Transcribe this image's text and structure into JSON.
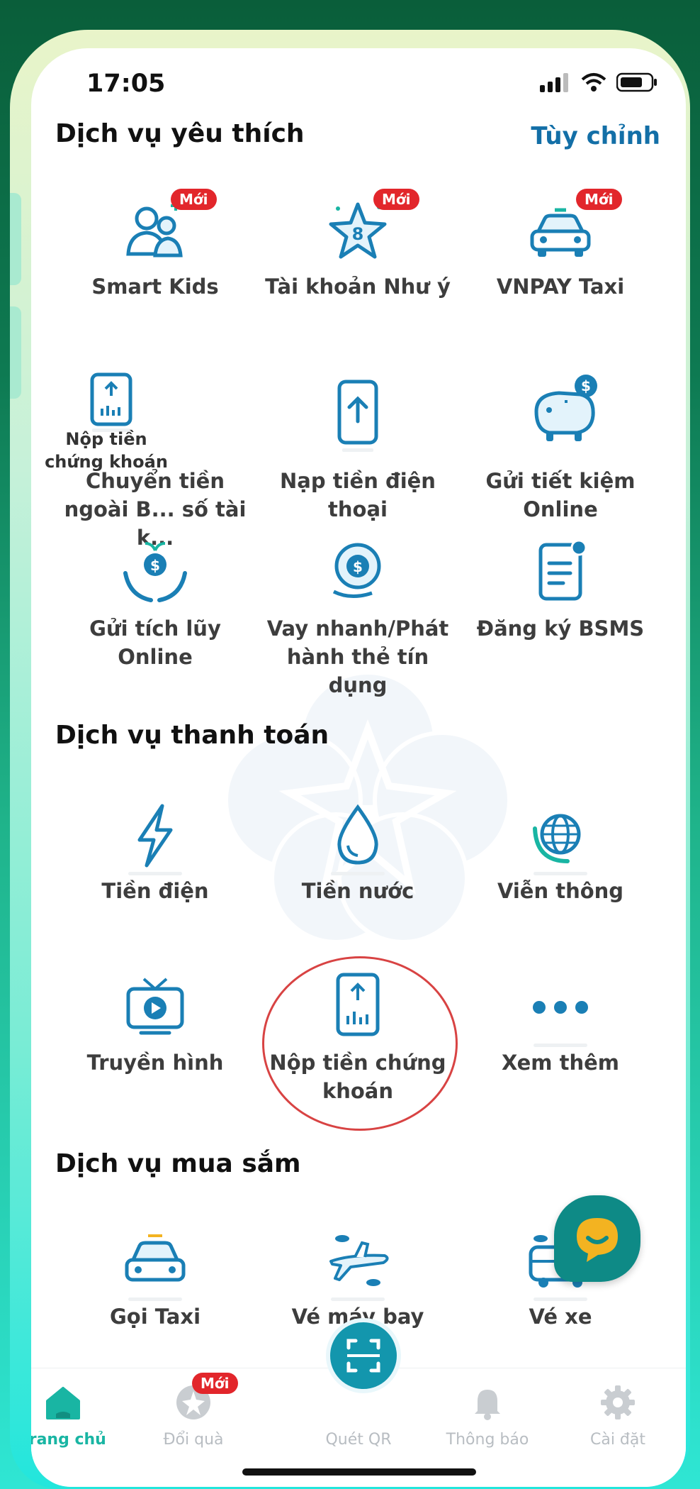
{
  "status_bar": {
    "time": "17:05"
  },
  "favorites": {
    "title": "Dịch vụ yêu thích",
    "customize_label": "Tùy chỉnh",
    "badge_text": "Mới",
    "items": [
      {
        "label": "Smart Kids",
        "icon": "kids-family-icon",
        "badge": true
      },
      {
        "label": "Tài khoản Như ý",
        "icon": "lucky-account-star-icon",
        "badge": true
      },
      {
        "label": "VNPAY Taxi",
        "icon": "taxi-car-icon",
        "badge": true
      },
      {
        "label": "Chuyển tiền ngoài B... số tài k...",
        "icon": "securities-deposit-icon",
        "badge": false
      },
      {
        "label": "Nạp tiền điện thoại",
        "icon": "phone-topup-icon",
        "badge": false
      },
      {
        "label": "Gửi tiết kiệm Online",
        "icon": "piggy-bank-icon",
        "badge": false
      },
      {
        "label": "Gửi tích lũy Online",
        "icon": "savings-hands-icon",
        "badge": false
      },
      {
        "label": "Vay nhanh/Phát hành thẻ tín dụng",
        "icon": "loan-icon",
        "badge": false
      },
      {
        "label": "Đăng ký BSMS",
        "icon": "document-icon",
        "badge": false
      }
    ],
    "drag_overlay_label": "Nộp tiền chứng khoán"
  },
  "payments": {
    "title": "Dịch vụ thanh toán",
    "items": [
      {
        "label": "Tiền điện",
        "icon": "lightning-icon"
      },
      {
        "label": "Tiền nước",
        "icon": "water-drop-icon"
      },
      {
        "label": "Viễn thông",
        "icon": "globe-icon"
      },
      {
        "label": "Truyền hình",
        "icon": "tv-icon"
      },
      {
        "label": "Nộp tiền chứng khoán",
        "icon": "securities-deposit-icon"
      },
      {
        "label": "Xem thêm",
        "icon": "more-dots-icon"
      }
    ]
  },
  "shopping": {
    "title": "Dịch vụ mua sắm",
    "items": [
      {
        "label": "Gọi Taxi",
        "icon": "taxi-car-icon"
      },
      {
        "label": "Vé máy bay",
        "icon": "airplane-icon"
      },
      {
        "label": "Vé xe",
        "icon": "bus-icon"
      }
    ]
  },
  "nav": {
    "badge_text": "Mới",
    "items": [
      {
        "label": "Trang chủ",
        "icon": "home-icon",
        "active": true
      },
      {
        "label": "Đổi quà",
        "icon": "gift-icon",
        "active": false
      },
      {
        "label": "Quét QR",
        "icon": "qr-scan-icon",
        "active": false
      },
      {
        "label": "Thông báo",
        "icon": "bell-icon",
        "active": false
      },
      {
        "label": "Cài đặt",
        "icon": "gear-icon",
        "active": false
      }
    ]
  },
  "colors": {
    "accent": "#136fa7",
    "icon_primary": "#1a7fb5",
    "icon_teal": "#19b5a3",
    "badge": "#e2262b",
    "circle_highlight": "#d84343"
  }
}
